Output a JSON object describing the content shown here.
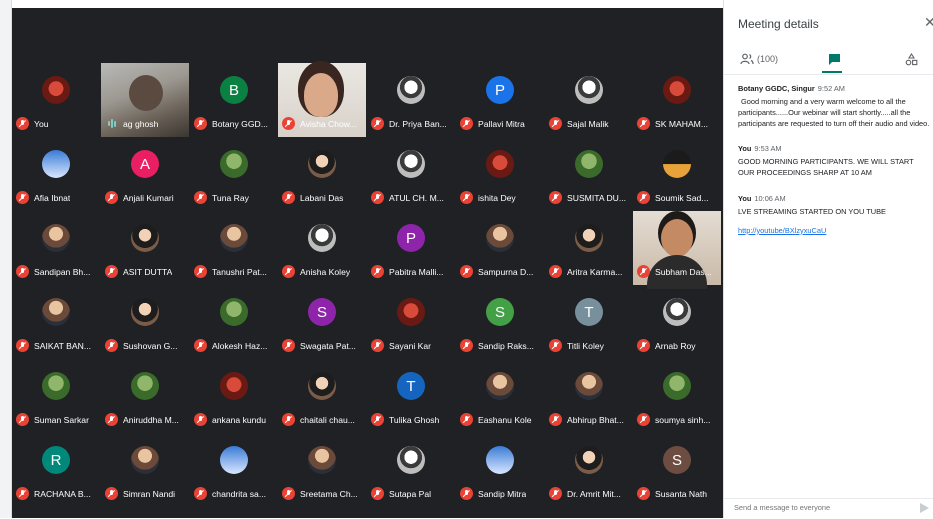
{
  "panel": {
    "title": "Meeting details",
    "people_count": "(100)",
    "compose_placeholder": "Send a message to everyone"
  },
  "messages": [
    {
      "sender": "Botany GGDC, Singur",
      "time": "9:52 AM",
      "text": "Good morning and a very warm welcome to all the participants......Our webinar will start shortly.....all the participants are requested to turn off their audio and video."
    },
    {
      "sender": "You",
      "time": "9:53 AM",
      "text": "GOOD MORNING PARTICIPANTS. WE WILL START OUR PROCEEDINGS SHARP AT 10 AM"
    },
    {
      "sender": "You",
      "time": "10:06 AM",
      "text": "LVE STREAMING STARTED ON YOU TUBE",
      "link": "http://youtube/BXlzyxuCaU"
    }
  ],
  "participants": [
    {
      "name": "You",
      "avatar": "photo-p5",
      "color": "",
      "mic": "muted"
    },
    {
      "name": "ag ghosh",
      "avatar": "video",
      "color": "",
      "mic": "speaking"
    },
    {
      "name": "Botany GGD...",
      "avatar": "B",
      "color": "#0b8043",
      "mic": "muted"
    },
    {
      "name": "Avisha Chow...",
      "avatar": "video",
      "color": "",
      "mic": "muted"
    },
    {
      "name": "Dr. Priya Ban...",
      "avatar": "photo-p4",
      "color": "",
      "mic": "muted"
    },
    {
      "name": "Pallavi Mitra",
      "avatar": "P",
      "color": "#1a73e8",
      "mic": "muted"
    },
    {
      "name": "Sajal Malik",
      "avatar": "photo-p4",
      "color": "",
      "mic": "muted"
    },
    {
      "name": "SK MAHAM...",
      "avatar": "photo-p5",
      "color": "",
      "mic": "muted"
    },
    {
      "name": "Afia Ibnat",
      "avatar": "photo-p6",
      "color": "",
      "mic": "muted"
    },
    {
      "name": "Anjali Kumari",
      "avatar": "A",
      "color": "#e91e63",
      "mic": "muted"
    },
    {
      "name": "Tuna Ray",
      "avatar": "photo-p3",
      "color": "",
      "mic": "muted"
    },
    {
      "name": "Labani Das",
      "avatar": "photo-p2",
      "color": "",
      "mic": "muted"
    },
    {
      "name": "ATUL CH. M...",
      "avatar": "photo-p4",
      "color": "",
      "mic": "muted"
    },
    {
      "name": "ishita Dey",
      "avatar": "photo-p5",
      "color": "",
      "mic": "muted"
    },
    {
      "name": "SUSMITA DU...",
      "avatar": "photo-p3",
      "color": "",
      "mic": "muted"
    },
    {
      "name": "Soumik Sad...",
      "avatar": "photo-p7",
      "color": "",
      "mic": "muted"
    },
    {
      "name": "Sandipan Bh...",
      "avatar": "photo",
      "color": "",
      "mic": "muted"
    },
    {
      "name": "ASIT DUTTA",
      "avatar": "photo-p2",
      "color": "",
      "mic": "muted"
    },
    {
      "name": "Tanushri Pat...",
      "avatar": "photo",
      "color": "",
      "mic": "muted"
    },
    {
      "name": "Anisha Koley",
      "avatar": "photo-p4",
      "color": "",
      "mic": "muted"
    },
    {
      "name": "Pabitra Malli...",
      "avatar": "P",
      "color": "#8e24aa",
      "mic": "muted"
    },
    {
      "name": "Sampurna D...",
      "avatar": "photo",
      "color": "",
      "mic": "muted"
    },
    {
      "name": "Aritra Karma...",
      "avatar": "photo-p2",
      "color": "",
      "mic": "muted"
    },
    {
      "name": "Subham Das...",
      "avatar": "video",
      "color": "",
      "mic": "muted"
    },
    {
      "name": "SAIKAT BAN...",
      "avatar": "photo",
      "color": "",
      "mic": "muted"
    },
    {
      "name": "Sushovan G...",
      "avatar": "photo-p2",
      "color": "",
      "mic": "muted"
    },
    {
      "name": "Alokesh Haz...",
      "avatar": "photo-p3",
      "color": "",
      "mic": "muted"
    },
    {
      "name": "Swagata Pat...",
      "avatar": "S",
      "color": "#8e24aa",
      "mic": "muted"
    },
    {
      "name": "Sayani Kar",
      "avatar": "photo-p5",
      "color": "",
      "mic": "muted"
    },
    {
      "name": "Sandip Raks...",
      "avatar": "S",
      "color": "#43a047",
      "mic": "muted"
    },
    {
      "name": "Titli Koley",
      "avatar": "T",
      "color": "#78909c",
      "mic": "muted"
    },
    {
      "name": "Arnab Roy",
      "avatar": "photo-p4",
      "color": "",
      "mic": "muted"
    },
    {
      "name": "Suman Sarkar",
      "avatar": "photo-p3",
      "color": "",
      "mic": "muted"
    },
    {
      "name": "Aniruddha M...",
      "avatar": "photo-p3",
      "color": "",
      "mic": "muted"
    },
    {
      "name": "ankana kundu",
      "avatar": "photo-p5",
      "color": "",
      "mic": "muted"
    },
    {
      "name": "chaitali chau...",
      "avatar": "photo-p2",
      "color": "",
      "mic": "muted"
    },
    {
      "name": "Tulika Ghosh",
      "avatar": "T",
      "color": "#1565c0",
      "mic": "muted"
    },
    {
      "name": "Eashanu Kole",
      "avatar": "photo",
      "color": "",
      "mic": "muted"
    },
    {
      "name": "Abhirup Bhat...",
      "avatar": "photo",
      "color": "",
      "mic": "muted"
    },
    {
      "name": "soumya sinh...",
      "avatar": "photo-p3",
      "color": "",
      "mic": "muted"
    },
    {
      "name": "RACHANA B...",
      "avatar": "R",
      "color": "#00897b",
      "mic": "muted"
    },
    {
      "name": "Simran Nandi",
      "avatar": "photo",
      "color": "",
      "mic": "muted"
    },
    {
      "name": "chandrita sa...",
      "avatar": "photo-p6",
      "color": "",
      "mic": "muted"
    },
    {
      "name": "Sreetama Ch...",
      "avatar": "photo",
      "color": "",
      "mic": "muted"
    },
    {
      "name": "Sutapa Pal",
      "avatar": "photo-p4",
      "color": "",
      "mic": "muted"
    },
    {
      "name": "Sandip Mitra",
      "avatar": "photo-p6",
      "color": "",
      "mic": "muted"
    },
    {
      "name": "Dr. Amrit Mit...",
      "avatar": "photo-p2",
      "color": "",
      "mic": "muted"
    },
    {
      "name": "Susanta Nath",
      "avatar": "S",
      "color": "#6d4c41",
      "mic": "muted"
    }
  ]
}
